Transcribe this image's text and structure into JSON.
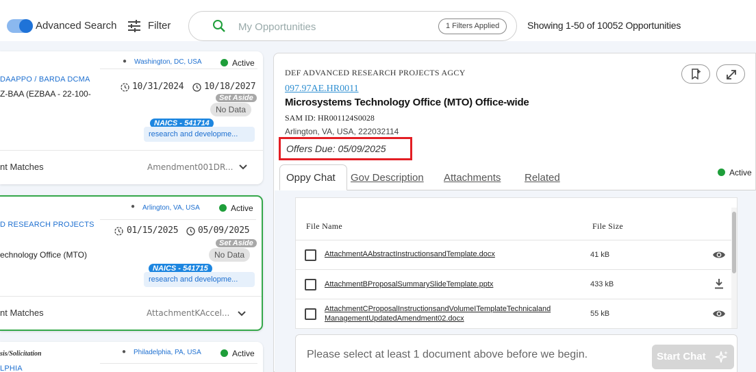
{
  "header": {
    "advanced_search_label": "Advanced Search",
    "advanced_search_on": true,
    "filter_label": "Filter",
    "search_placeholder": "My Opportunities",
    "filters_applied": "1 Filters Applied",
    "showing": "Showing 1-50 of 10052 Opportunities"
  },
  "cards": [
    {
      "location": "Washington, DC, USA",
      "status": "Active",
      "agency": "DAAPPO / BARDA DCMA",
      "subtitle": "Z-BAA (EZBAA - 22-100-",
      "date_posted": "10/31/2024",
      "date_due": "10/18/2027",
      "set_aside_label": "Set Aside",
      "set_aside_value": "No Data",
      "naics": "NAICS - 541714",
      "naics_desc": "research and developme...",
      "matches_label": "nt Matches",
      "matches_value": "Amendment001DR..."
    },
    {
      "location": "Arlington, VA, USA",
      "status": "Active",
      "agency": "D RESEARCH PROJECTS",
      "subtitle": "echnology Office (MTO)",
      "date_posted": "01/15/2025",
      "date_due": "05/09/2025",
      "set_aside_label": "Set Aside",
      "set_aside_value": "No Data",
      "naics": "NAICS - 541715",
      "naics_desc": "research and developme...",
      "matches_label": "nt Matches",
      "matches_value": "AttachmentKAccel..."
    },
    {
      "location": "Philadelphia, PA, USA",
      "status": "Active",
      "agency": "sis/Solicitation",
      "subtitle": "LPHIA"
    }
  ],
  "detail": {
    "agency": "DEF ADVANCED RESEARCH PROJECTS AGCY",
    "solicitation_number": "097.97AE.HR0011",
    "title": "Microsystems Technology Office (MTO) Office-wide",
    "sam_id": "SAM ID: HR001124S0028",
    "address": "Arlington, VA, USA, 222032114",
    "offers_due": "Offers Due: 05/09/2025",
    "status": "Active",
    "tabs": [
      "Oppy Chat",
      "Gov Description",
      "Attachments",
      "Related"
    ],
    "active_tab": "Oppy Chat",
    "files_header": {
      "name": "File Name",
      "size": "File Size"
    },
    "files": [
      {
        "name": "AttachmentAAbstractInstructionsandTemplate.docx",
        "size": "41 kB",
        "icon": "eye-icon"
      },
      {
        "name": "AttachmentBProposalSummarySlideTemplate.pptx",
        "size": "433 kB",
        "icon": "download-icon"
      },
      {
        "name_line1": "AttachmentCProposalInstructionsandVolumeITemplateTechnicaland",
        "name_line2": "ManagementUpdatedAmendment02.docx",
        "size": "55 kB",
        "icon": "eye-icon"
      }
    ],
    "chat_placeholder": "Please select at least 1 document above before we begin.",
    "start_chat": "Start Chat"
  },
  "colors": {
    "accent_blue": "#1d86e0",
    "active_green": "#1e9e3a",
    "highlight_red": "#e31e24",
    "selected_border": "#35a84a"
  }
}
